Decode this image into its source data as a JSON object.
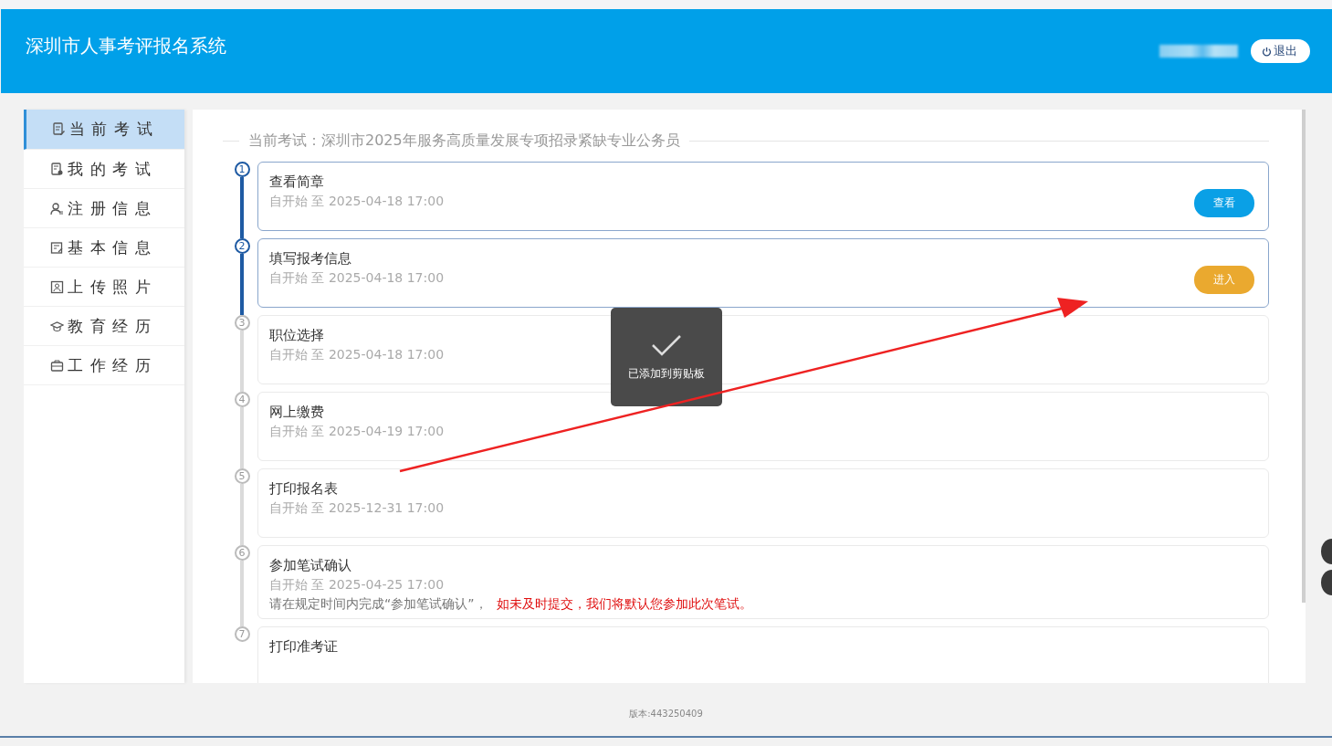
{
  "header": {
    "title": "深圳市人事考评报名系统",
    "logout_button": "退出"
  },
  "sidebar": {
    "items": [
      {
        "label": "当前考试",
        "kind": "doc-pen",
        "selected": true
      },
      {
        "label": "我的考试",
        "kind": "doc-badge",
        "selected": false
      },
      {
        "label": "注册信息",
        "kind": "user",
        "selected": false
      },
      {
        "label": "基本信息",
        "kind": "form",
        "selected": false
      },
      {
        "label": "上传照片",
        "kind": "photo",
        "selected": false
      },
      {
        "label": "教育经历",
        "kind": "cap",
        "selected": false
      },
      {
        "label": "工作经历",
        "kind": "briefcase",
        "selected": false
      }
    ]
  },
  "exam": {
    "heading": "当前考试：深圳市2025年服务高质量发展专项招录紧缺专业公务员"
  },
  "steps": [
    {
      "number": "1",
      "title": "查看简章",
      "period": "自开始 至 2025-04-18 17:00",
      "active": true,
      "button": {
        "label": "查看",
        "kind": "primary"
      }
    },
    {
      "number": "2",
      "title": "填写报考信息",
      "period": "自开始 至 2025-04-18 17:00",
      "active": true,
      "button": {
        "label": "进入",
        "kind": "warning"
      }
    },
    {
      "number": "3",
      "title": "职位选择",
      "period": "自开始 至 2025-04-18 17:00",
      "active": false
    },
    {
      "number": "4",
      "title": "网上缴费",
      "period": "自开始 至 2025-04-19 17:00",
      "active": false
    },
    {
      "number": "5",
      "title": "打印报名表",
      "period": "自开始 至 2025-12-31 17:00",
      "active": false
    },
    {
      "number": "6",
      "title": "参加笔试确认",
      "period": "自开始 至 2025-04-25 17:00",
      "active": false,
      "note": "请在规定时间内完成“参加笔试确认”，",
      "warning": "如未及时提交，我们将默认您参加此次笔试。"
    },
    {
      "number": "7",
      "title": "打印准考证",
      "active": false
    }
  ],
  "toast": {
    "message": "已添加到剪贴板"
  },
  "footer": {
    "version": "版本:443250409"
  }
}
